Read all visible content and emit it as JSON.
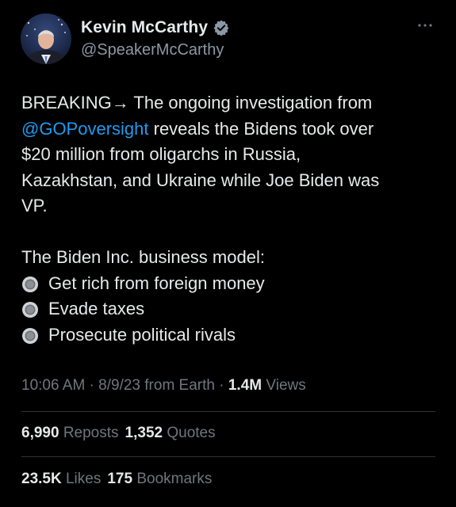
{
  "author": {
    "display_name": "Kevin McCarthy",
    "handle": "@SpeakerMcCarthy",
    "verified_color": "#8b98a5"
  },
  "tweet": {
    "line1": "BREAKING→ The ongoing investigation from",
    "mention": "@GOPoversight",
    "line2_rest": " reveals the Bidens took over",
    "line3": "$20 million from oligarchs in Russia,",
    "line4": "Kazakhstan, and Ukraine while Joe Biden was",
    "line5": "VP.",
    "model_heading": "The Biden Inc. business model:",
    "bullets": [
      "Get rich from foreign money",
      "Evade taxes",
      "Prosecute political rivals"
    ]
  },
  "meta": {
    "time": "10:06 AM",
    "sep1": " · ",
    "date_source": "8/9/23 from Earth",
    "sep2": " · ",
    "views_count": "1.4M",
    "views_label": " Views"
  },
  "stats": {
    "reposts_count": "6,990",
    "reposts_label": "Reposts",
    "quotes_count": "1,352",
    "quotes_label": "Quotes",
    "likes_count": "23.5K",
    "likes_label": "Likes",
    "bookmarks_count": "175",
    "bookmarks_label": "Bookmarks"
  },
  "colors": {
    "background": "#000000",
    "text": "#e7e9ea",
    "muted": "#71767b",
    "link": "#1d9bf0",
    "divider": "#2f3336"
  },
  "icons": {
    "verified": "verified-badge-icon",
    "more": "more-options-icon",
    "bullet": "radio-button-icon"
  }
}
